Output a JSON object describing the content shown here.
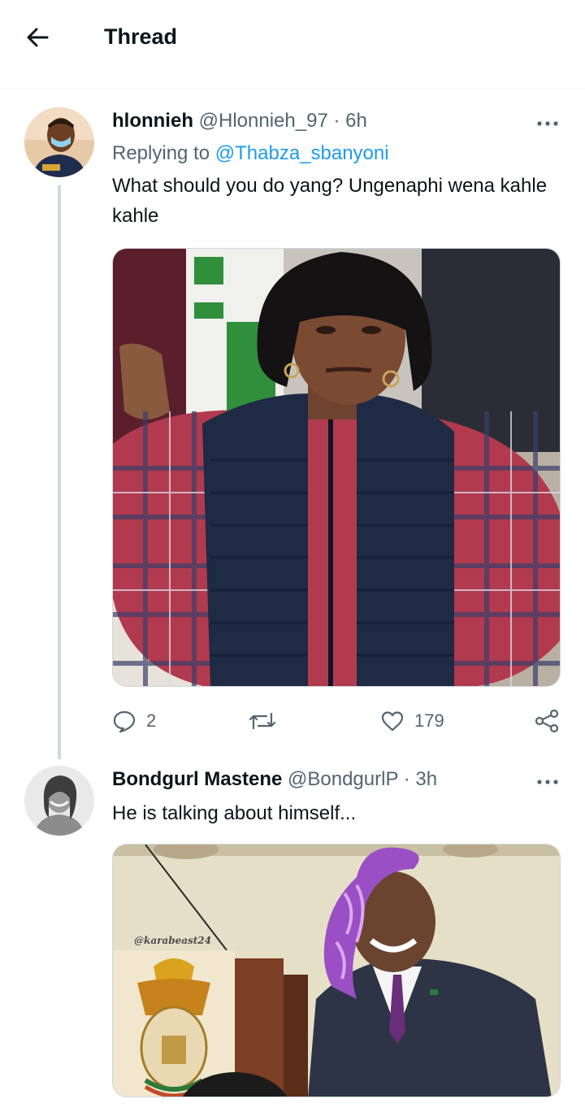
{
  "header": {
    "title": "Thread"
  },
  "tweets": [
    {
      "name": "hlonnieh",
      "handle": "@Hlonnieh_97",
      "time": "· 6h",
      "replying_prefix": "Replying to",
      "replying_to": "@Thabza_sbanyoni",
      "text": "What should you do yang? Ungenaphi wena kahle kahle",
      "replies": "2",
      "retweets": "",
      "likes": "179"
    },
    {
      "name": "Bondgurl Mastene",
      "handle": "@BondgurlP",
      "time": "· 3h",
      "text": "He is talking about himself...",
      "watermark": "@karabeast24"
    }
  ],
  "icons": {
    "back": "arrow-left-icon",
    "more": "more-horizontal-icon",
    "reply": "speech-bubble-icon",
    "retweet": "retweet-icon",
    "like": "heart-icon",
    "share": "share-nodes-icon"
  },
  "colors": {
    "text": "#0f1419",
    "secondary": "#536471",
    "link": "#1d9bf0",
    "border": "#cfd9de"
  }
}
